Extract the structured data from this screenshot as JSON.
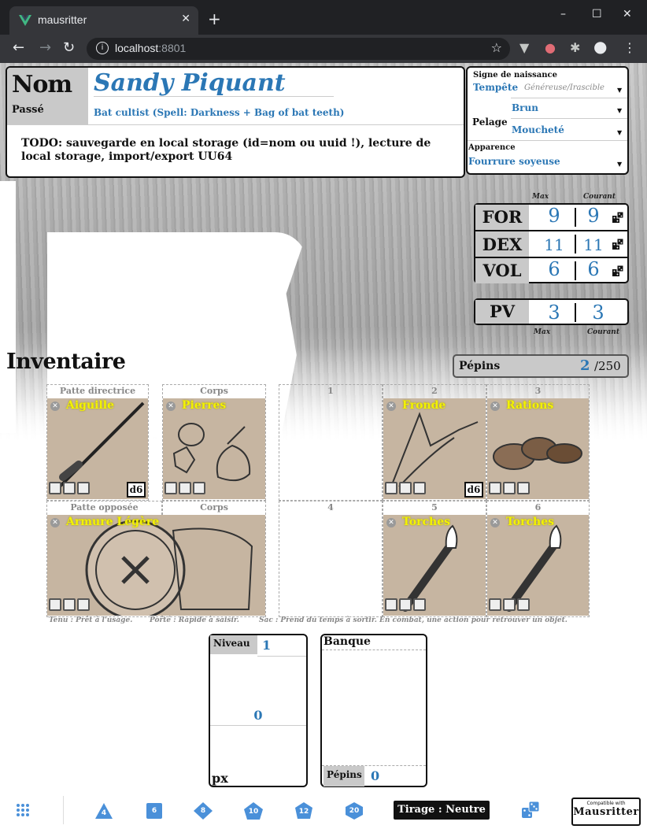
{
  "browser": {
    "tab_title": "mausritter",
    "new_tab": "+",
    "url_host": "localhost",
    "url_port": ":8801",
    "win_min": "–",
    "win_max": "☐",
    "win_close": "✕"
  },
  "header": {
    "nom_label": "Nom",
    "passe_label": "Passé",
    "name": "Sandy Piquant",
    "background": "Bat cultist (Spell: Darkness + Bag of bat teeth)",
    "notes": "TODO: sauvegarde en local storage (id=nom ou uuid !), lecture de local storage, import/export UU64"
  },
  "side": {
    "birthsign_label": "Signe de naissance",
    "birthsign_value": "Tempête",
    "birthsign_sub": "Généreuse/Irascible",
    "coat_label": "Pelage",
    "coat_color": "Brun",
    "coat_pattern": "Moucheté",
    "look_label": "Apparence",
    "look_value": "Fourrure soyeuse"
  },
  "stats": {
    "max_label": "Max",
    "current_label": "Courant",
    "rows": [
      {
        "label": "FOR",
        "max": "9",
        "current": "9"
      },
      {
        "label": "DEX",
        "max": "11",
        "current": "11"
      },
      {
        "label": "VOL",
        "max": "6",
        "current": "6"
      }
    ],
    "hp": {
      "label": "PV",
      "max": "3",
      "current": "3"
    }
  },
  "pepins": {
    "label": "Pépins",
    "value": "2",
    "max": "/250"
  },
  "inventory": {
    "title": "Inventaire",
    "slot_labels": {
      "paw_main": "Patte directrice",
      "body1": "Corps",
      "paw_off": "Patte opposée",
      "body2": "Corps",
      "p1": "1",
      "p2": "2",
      "p3": "3",
      "p4": "4",
      "p5": "5",
      "p6": "6"
    },
    "items": {
      "aiguille": {
        "name": "Aiguille",
        "damage": "d6"
      },
      "pierres": {
        "name": "Pierres"
      },
      "fronde": {
        "name": "Fronde",
        "damage": "d6"
      },
      "rations": {
        "name": "Rations"
      },
      "armure": {
        "name": "Armure Légère"
      },
      "torches1": {
        "name": "Torches"
      },
      "torches2": {
        "name": "Torches"
      }
    },
    "legend": {
      "held": "Tenu : Prêt à l'usage.",
      "worn": "Porté : Rapide à saisir.",
      "pack": "Sac : Prend du temps à sortir. En combat, une action pour retrouver un objet."
    }
  },
  "level": {
    "label": "Niveau",
    "value": "1",
    "xp": "0",
    "xp_label": "px"
  },
  "bank": {
    "label": "Banque",
    "pepins_label": "Pépins",
    "pepins_value": "0"
  },
  "footer": {
    "dice": [
      "4",
      "6",
      "8",
      "10",
      "12",
      "20"
    ],
    "tirage": "Tirage : Neutre",
    "compat_small": "Compatible with",
    "compat_big": "Mausritter"
  },
  "colors": {
    "accent": "#2b77b5",
    "item_name": "#f2f200",
    "label_bg": "#c9c9c9"
  }
}
